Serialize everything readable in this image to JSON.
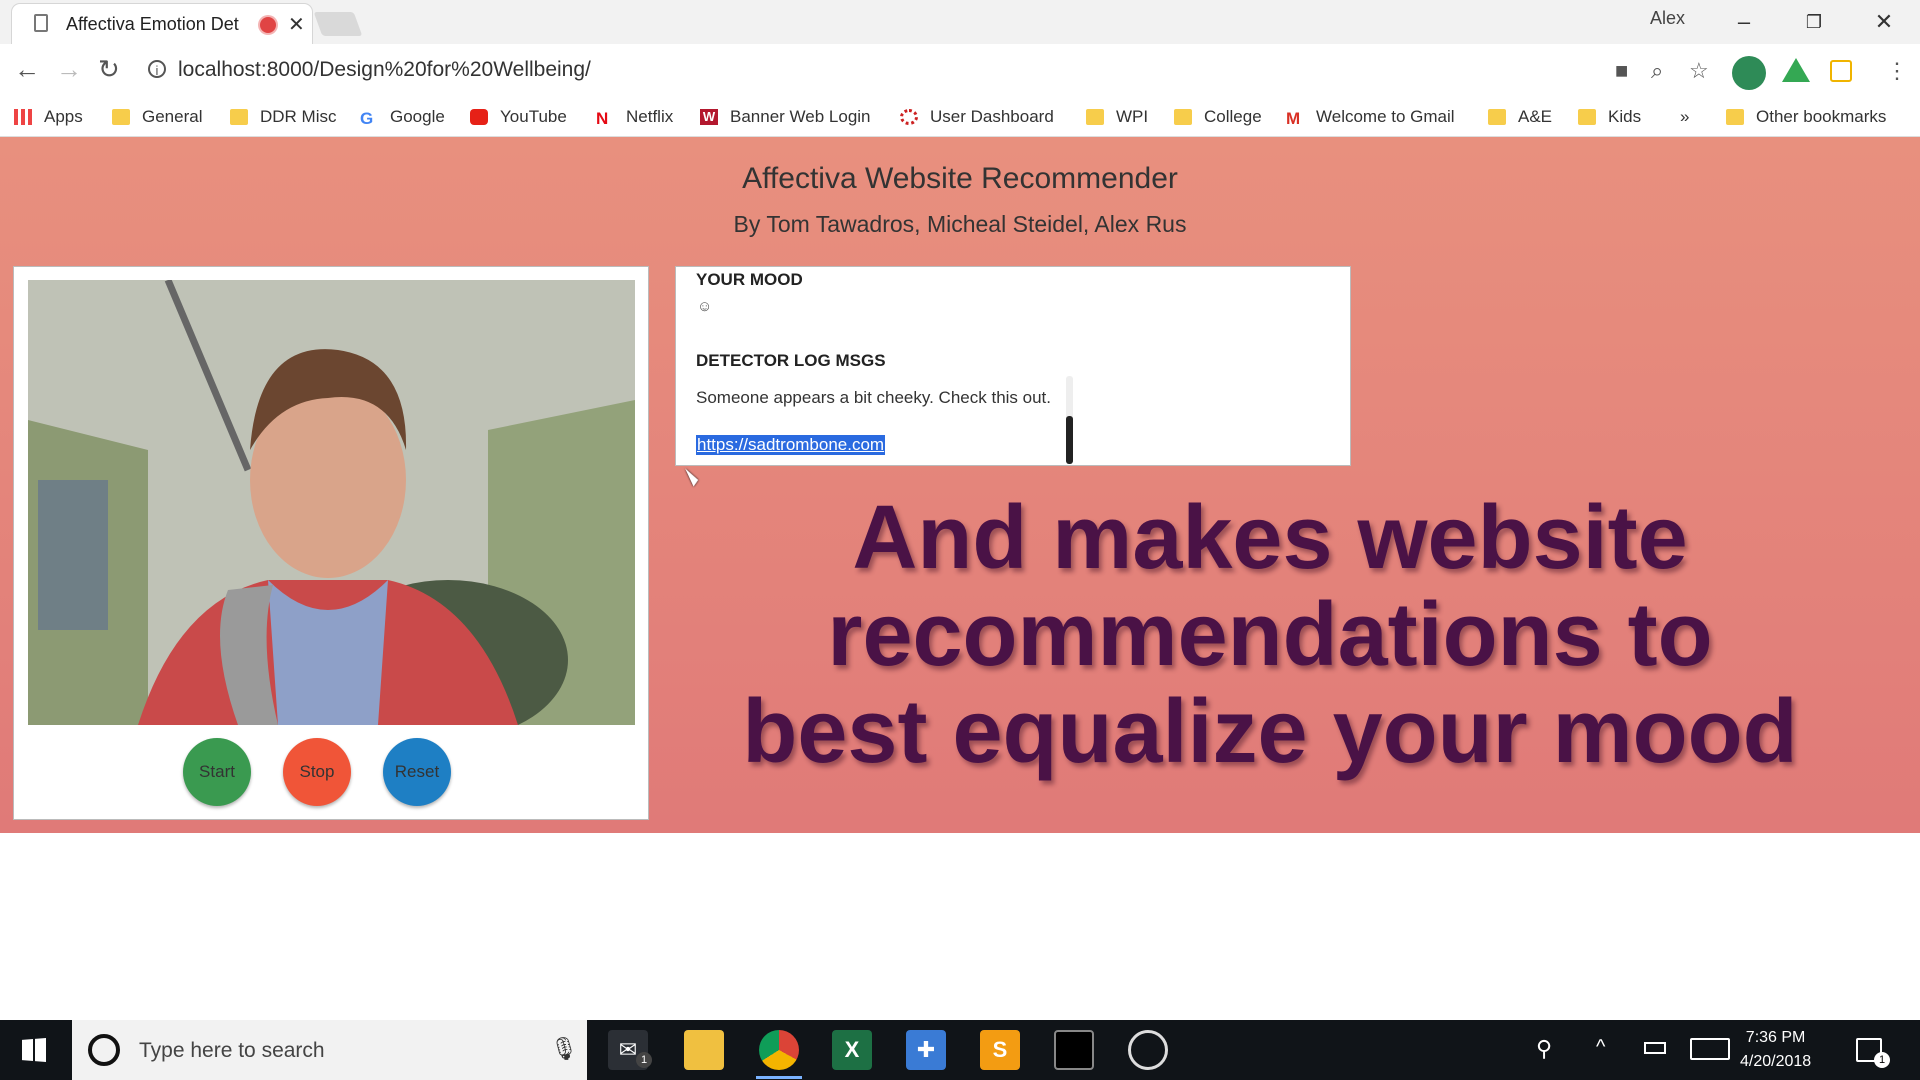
{
  "browser": {
    "tab_title": "Affectiva Emotion Det",
    "user": "Alex",
    "url": "localhost:8000/Design%20for%20Wellbeing/"
  },
  "bookmarks": [
    {
      "label": "Apps",
      "icon": "apps-grid-icon"
    },
    {
      "label": "General",
      "icon": "folder-icon"
    },
    {
      "label": "DDR Misc",
      "icon": "folder-icon"
    },
    {
      "label": "Google",
      "icon": "google-icon"
    },
    {
      "label": "YouTube",
      "icon": "youtube-icon"
    },
    {
      "label": "Netflix",
      "icon": "netflix-icon"
    },
    {
      "label": "Banner Web Login",
      "icon": "wpi-w-icon"
    },
    {
      "label": "User Dashboard",
      "icon": "dashboard-icon"
    },
    {
      "label": "WPI",
      "icon": "folder-icon"
    },
    {
      "label": "College",
      "icon": "folder-icon"
    },
    {
      "label": "Welcome to Gmail",
      "icon": "gmail-icon"
    },
    {
      "label": "A&E",
      "icon": "folder-icon"
    },
    {
      "label": "Kids",
      "icon": "folder-icon"
    }
  ],
  "bookmarks_overflow": "»",
  "other_bookmarks": "Other bookmarks",
  "page": {
    "title": "Affectiva Website Recommender",
    "subtitle": "By Tom Tawadros, Micheal Steidel, Alex Rus",
    "buttons": {
      "start": "Start",
      "stop": "Stop",
      "reset": "Reset"
    },
    "button_colors": {
      "start": "#3a9a50",
      "stop": "#f05538",
      "reset": "#1e7fc4"
    },
    "mood_label": "YOUR MOOD",
    "mood_emoji": "☺",
    "log_label": "DETECTOR LOG MSGS",
    "log_message": "Someone appears a bit cheeky. Check this out.",
    "log_link": "https://sadtrombone.com"
  },
  "overlay": {
    "line1": "And makes website",
    "line2": "recommendations to",
    "line3": "best equalize your mood"
  },
  "taskbar": {
    "search_placeholder": "Type here to search",
    "time": "7:36 PM",
    "date": "4/20/2018",
    "mail_badge": "1",
    "notification_badge": "1"
  }
}
